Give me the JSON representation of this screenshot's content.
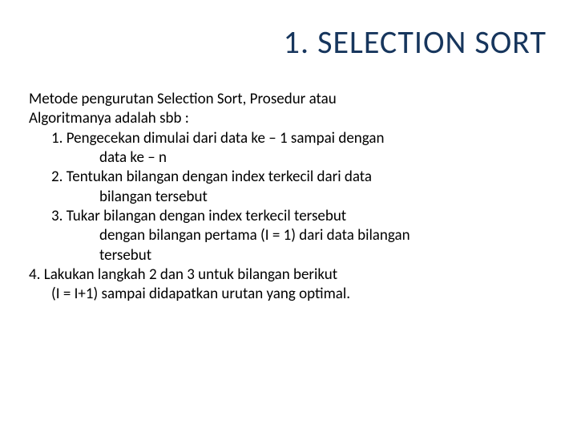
{
  "title": "1.   SELECTION SORT",
  "intro_line1": "Metode pengurutan Selection Sort, Prosedur atau",
  "intro_line2": "Algoritmanya adalah sbb :",
  "step1_line1": "1. Pengecekan dimulai dari data ke – 1 sampai dengan",
  "step1_line2": "data ke – n",
  "step2_line1": "2. Tentukan bilangan dengan index terkecil dari data",
  "step2_line2": "bilangan tersebut",
  "step3_line1": "3. Tukar  bilangan  dengan index  terkecil  tersebut",
  "step3_line2": "dengan  bilangan  pertama (I = 1) dari data bilangan",
  "step3_line3": "tersebut",
  "step4_line1": "4. Lakukan langkah 2 dan 3 untuk bilangan berikut",
  "step4_line2": "(I = I+1)  sampai didapatkan urutan yang optimal."
}
